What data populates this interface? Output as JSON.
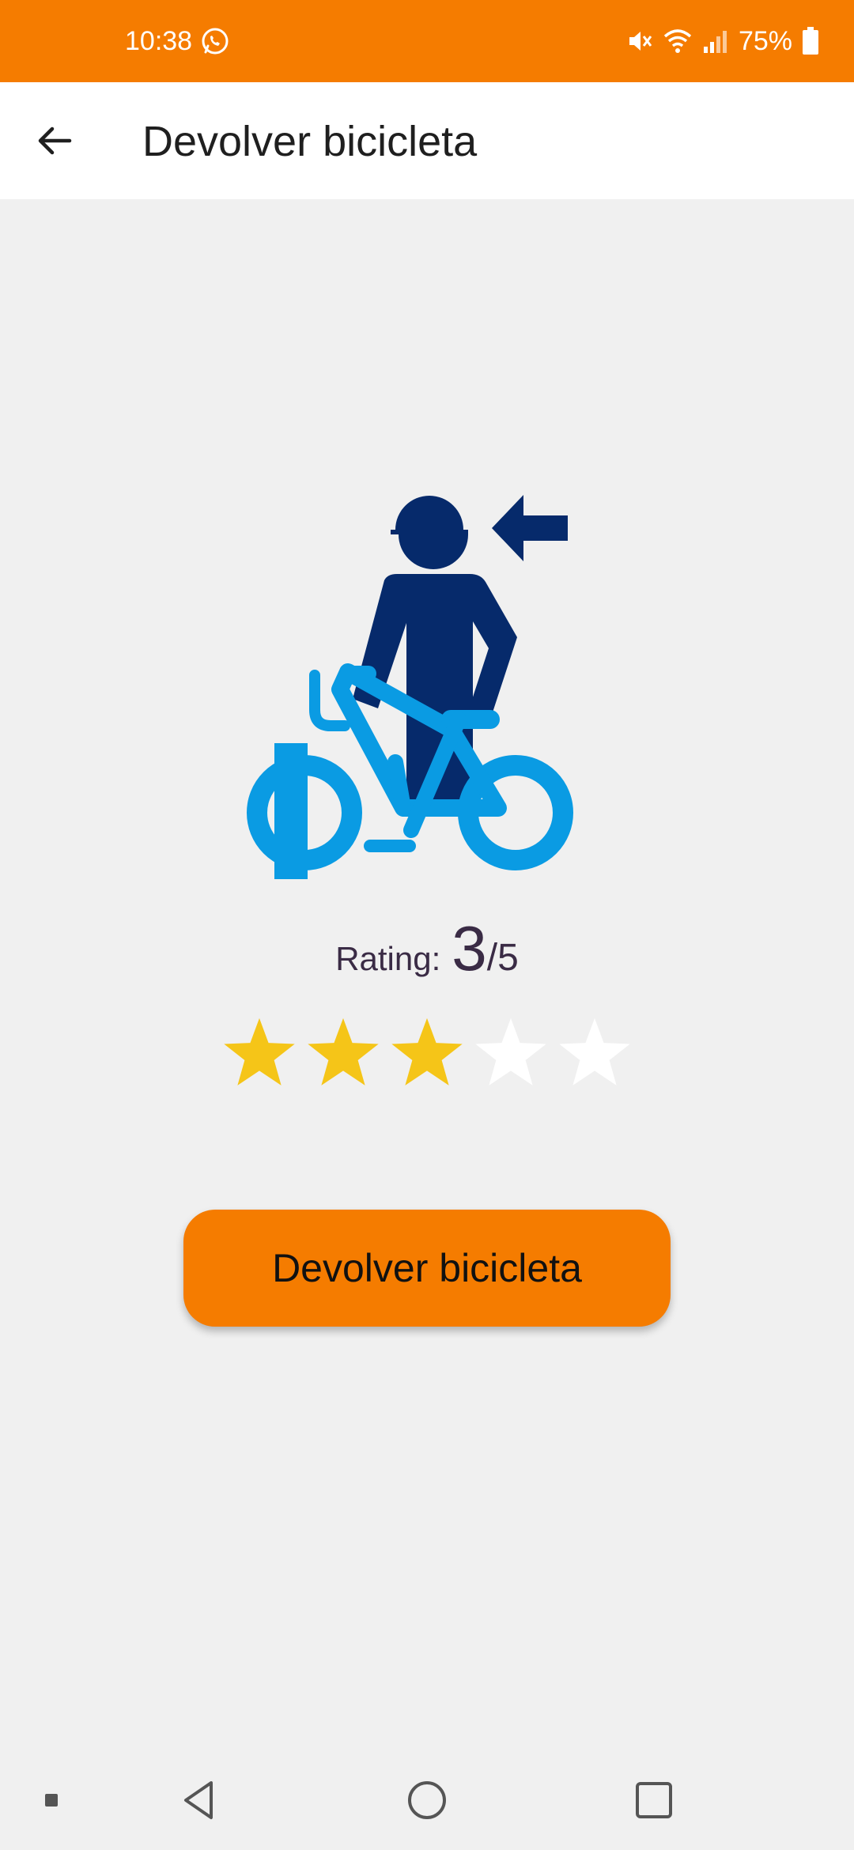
{
  "status_bar": {
    "time": "10:38",
    "battery_percent": "75%",
    "icons": [
      "whatsapp-icon",
      "mute-icon",
      "wifi-icon",
      "signal-icon",
      "battery-icon"
    ],
    "background_color": "#f57c00"
  },
  "app_bar": {
    "title": "Devolver bicicleta",
    "back_icon": "arrow-left-icon"
  },
  "rating": {
    "label": "Rating:",
    "value": "3",
    "total": "/5",
    "stars_filled": 3,
    "stars_max": 5,
    "filled_color": "#f5c518",
    "empty_color": "#ffffff"
  },
  "actions": {
    "return_button_label": "Devolver bicicleta",
    "accent_color": "#f57c00"
  },
  "illustration": {
    "person_color": "#062a6b",
    "bike_color": "#0a9be3"
  },
  "nav_bar": {
    "icons": [
      "recent-dot-icon",
      "back-triangle-icon",
      "home-circle-icon",
      "overview-square-icon"
    ]
  }
}
